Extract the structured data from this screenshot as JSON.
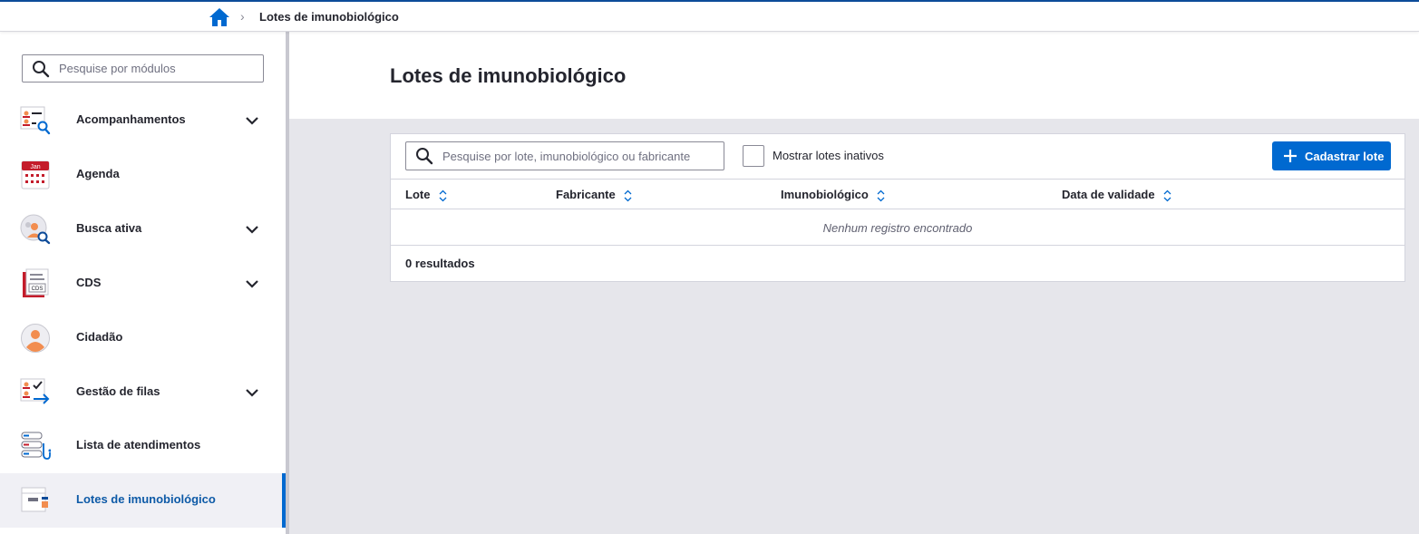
{
  "breadcrumb": {
    "home_icon": "home-icon",
    "current": "Lotes de imunobiológico"
  },
  "sidebar": {
    "search_placeholder": "Pesquise por módulos",
    "items": [
      {
        "label": "Acompanhamentos",
        "icon": "acompanhamentos-icon",
        "expandable": true
      },
      {
        "label": "Agenda",
        "icon": "calendar-icon",
        "calendar_text": "Jan",
        "expandable": false
      },
      {
        "label": "Busca ativa",
        "icon": "busca-ativa-icon",
        "expandable": true
      },
      {
        "label": "CDS",
        "icon": "cds-document-icon",
        "doc_text": "CDS",
        "expandable": true
      },
      {
        "label": "Cidadão",
        "icon": "person-icon",
        "expandable": false
      },
      {
        "label": "Gestão de filas",
        "icon": "queue-icon",
        "expandable": true
      },
      {
        "label": "Lista de atendimentos",
        "icon": "stethoscope-list-icon",
        "expandable": false
      },
      {
        "label": "Lotes de imunobiológico",
        "icon": "box-icon",
        "expandable": false,
        "active": true
      }
    ]
  },
  "main": {
    "title": "Lotes de imunobiológico",
    "search_placeholder": "Pesquise por lote, imunobiológico ou fabricante",
    "checkbox_label": "Mostrar lotes inativos",
    "primary_button": "Cadastrar lote",
    "table": {
      "columns": [
        "Lote",
        "Fabricante",
        "Imunobiológico",
        "Data de validade"
      ],
      "empty_message": "Nenhum registro encontrado",
      "results_label": "0 resultados"
    }
  },
  "colors": {
    "primary": "#0069d0",
    "active_text": "#0d5aa7",
    "top_border": "#0d4b99",
    "accent_orange": "#f28d4f",
    "accent_red": "#c41c2b"
  }
}
